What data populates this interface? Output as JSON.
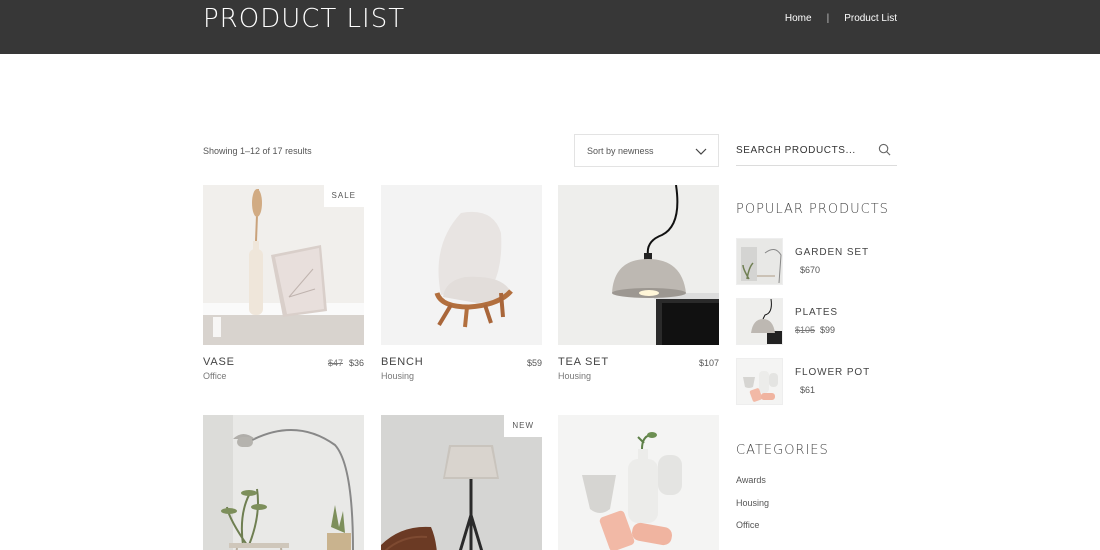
{
  "header": {
    "title": "PRODUCT LIST",
    "breadcrumb": [
      "Home",
      "|",
      "Product List"
    ]
  },
  "toolbar": {
    "results_text": "Showing 1–12 of 17 results",
    "sort_value": "Sort by newness"
  },
  "products": [
    {
      "name": "VASE",
      "old_price": "$47",
      "price": "$36",
      "category": "Office",
      "badge": "SALE"
    },
    {
      "name": "BENCH",
      "old_price": "",
      "price": "$59",
      "category": "Housing",
      "badge": ""
    },
    {
      "name": "TEA SET",
      "old_price": "",
      "price": "$107",
      "category": "Housing",
      "badge": ""
    },
    {
      "name": "",
      "old_price": "",
      "price": "",
      "category": "",
      "badge": ""
    },
    {
      "name": "",
      "old_price": "",
      "price": "",
      "category": "",
      "badge": "NEW"
    },
    {
      "name": "",
      "old_price": "",
      "price": "",
      "category": "",
      "badge": ""
    }
  ],
  "sidebar": {
    "search_placeholder": "SEARCH PRODUCTS...",
    "popular_title": "POPULAR PRODUCTS",
    "popular": [
      {
        "name": "GARDEN SET",
        "old_price": "",
        "price": "$670"
      },
      {
        "name": "PLATES",
        "old_price": "$105",
        "price": "$99"
      },
      {
        "name": "FLOWER POT",
        "old_price": "",
        "price": "$61"
      }
    ],
    "categories_title": "CATEGORIES",
    "categories": [
      "Awards",
      "Housing",
      "Office"
    ]
  },
  "icons": {
    "search": "search-icon",
    "sort": "chevron-down-icon"
  },
  "colors": {
    "header_bg": "#373737",
    "page_bg": "#ffffff"
  }
}
